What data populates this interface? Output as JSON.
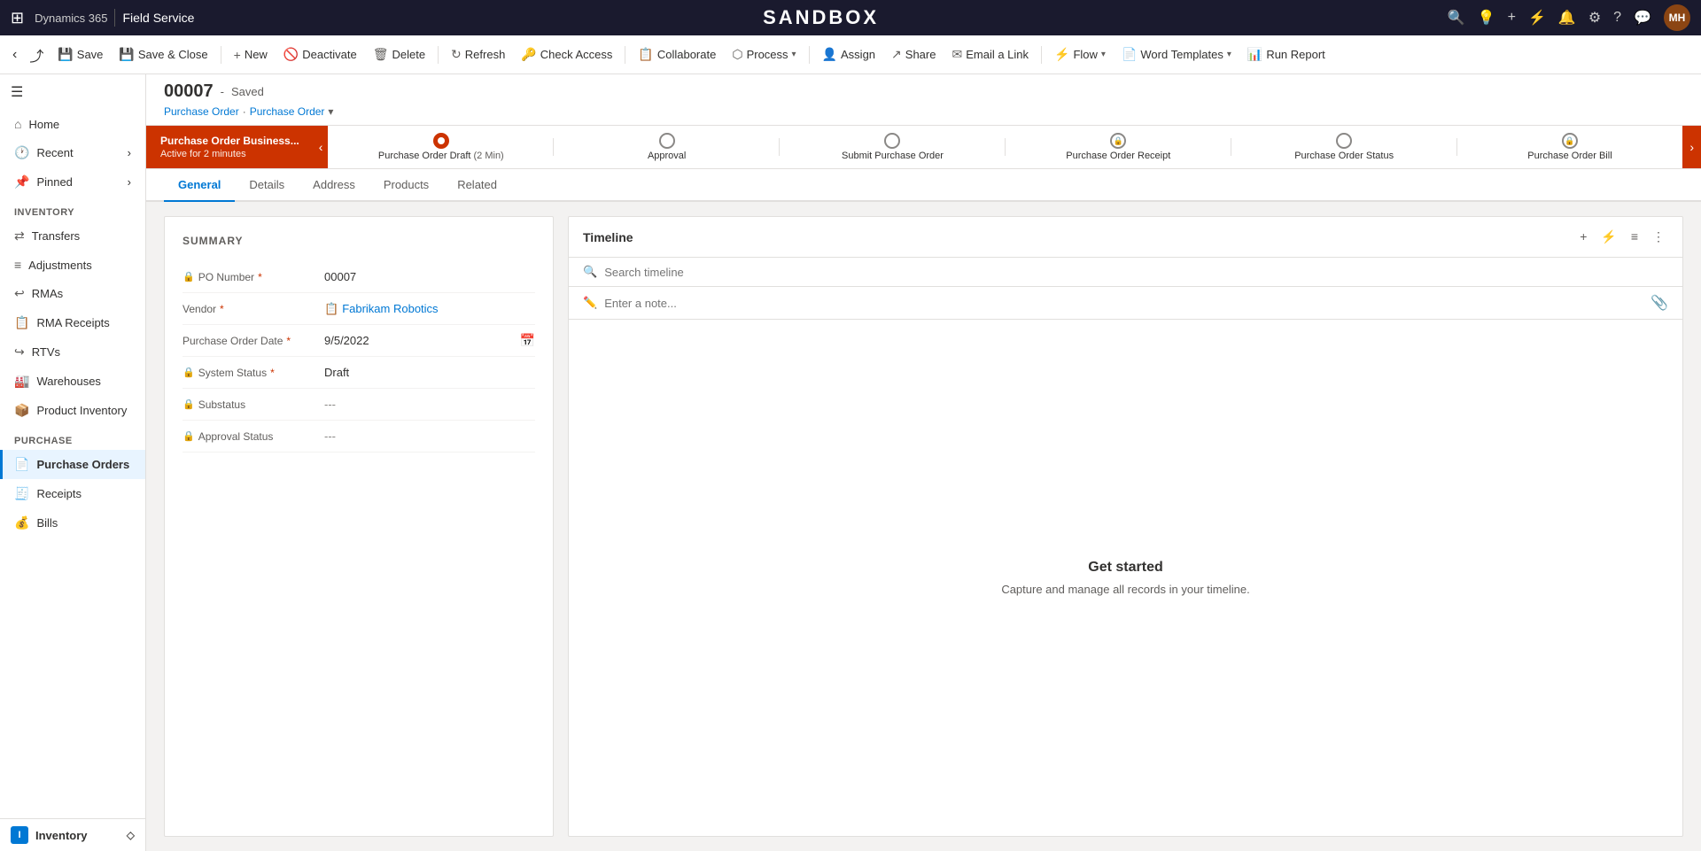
{
  "topbar": {
    "app_name": "Dynamics 365",
    "module": "Field Service",
    "sandbox_label": "SANDBOX",
    "avatar_initials": "MH"
  },
  "commandbar": {
    "back_btn": "‹",
    "forward_btn": "›",
    "save_label": "Save",
    "save_close_label": "Save & Close",
    "new_label": "New",
    "deactivate_label": "Deactivate",
    "delete_label": "Delete",
    "refresh_label": "Refresh",
    "check_access_label": "Check Access",
    "collaborate_label": "Collaborate",
    "process_label": "Process",
    "assign_label": "Assign",
    "share_label": "Share",
    "email_link_label": "Email a Link",
    "flow_label": "Flow",
    "word_templates_label": "Word Templates",
    "run_report_label": "Run Report"
  },
  "record": {
    "id": "00007",
    "status": "Saved",
    "breadcrumb_parent": "Purchase Order",
    "breadcrumb_current": "Purchase Order"
  },
  "process_bar": {
    "active_stage_name": "Purchase Order Business...",
    "active_stage_sub": "Active for 2 minutes",
    "stages": [
      {
        "label": "Purchase Order Draft",
        "time": "(2 Min)",
        "active": true
      },
      {
        "label": "Approval",
        "active": false
      },
      {
        "label": "Submit Purchase Order",
        "active": false
      },
      {
        "label": "Purchase Order Receipt",
        "active": false,
        "locked": true
      },
      {
        "label": "Purchase Order Status",
        "active": false
      },
      {
        "label": "Purchase Order Bill",
        "active": false,
        "locked": true
      }
    ]
  },
  "tabs": [
    {
      "label": "General",
      "active": true
    },
    {
      "label": "Details",
      "active": false
    },
    {
      "label": "Address",
      "active": false
    },
    {
      "label": "Products",
      "active": false
    },
    {
      "label": "Related",
      "active": false
    }
  ],
  "summary": {
    "section_title": "SUMMARY",
    "fields": [
      {
        "label": "PO Number",
        "value": "00007",
        "required": true,
        "has_lock": true
      },
      {
        "label": "Vendor",
        "value": "Fabrikam Robotics",
        "required": true,
        "is_link": true,
        "has_lock": false
      },
      {
        "label": "Purchase Order Date",
        "value": "9/5/2022",
        "required": true,
        "has_calendar": true,
        "has_lock": false
      },
      {
        "label": "System Status",
        "value": "Draft",
        "required": true,
        "has_lock": true
      },
      {
        "label": "Substatus",
        "value": "---",
        "required": false,
        "has_lock": true
      },
      {
        "label": "Approval Status",
        "value": "---",
        "required": false,
        "has_lock": true
      }
    ]
  },
  "timeline": {
    "title": "Timeline",
    "search_placeholder": "Search timeline",
    "note_placeholder": "Enter a note...",
    "empty_title": "Get started",
    "empty_sub": "Capture and manage all records in your timeline."
  },
  "sidebar": {
    "toggle_icon": "☰",
    "nav_items": [
      {
        "label": "Home",
        "icon": "⌂",
        "has_arrow": false
      },
      {
        "label": "Recent",
        "icon": "🕐",
        "has_arrow": true
      },
      {
        "label": "Pinned",
        "icon": "📌",
        "has_arrow": true
      }
    ],
    "inventory_section": "Inventory",
    "inventory_items": [
      {
        "label": "Transfers",
        "icon": "⇄"
      },
      {
        "label": "Adjustments",
        "icon": "≡"
      },
      {
        "label": "RMAs",
        "icon": "↩"
      },
      {
        "label": "RMA Receipts",
        "icon": "📋"
      },
      {
        "label": "RTVs",
        "icon": "↪"
      },
      {
        "label": "Warehouses",
        "icon": "🏭"
      },
      {
        "label": "Product Inventory",
        "icon": "📦"
      }
    ],
    "purchase_section": "Purchase",
    "purchase_items": [
      {
        "label": "Purchase Orders",
        "icon": "📄",
        "active": true
      },
      {
        "label": "Receipts",
        "icon": "🧾"
      },
      {
        "label": "Bills",
        "icon": "💰"
      }
    ],
    "bottom_label": "Inventory",
    "bottom_icon": "I"
  }
}
